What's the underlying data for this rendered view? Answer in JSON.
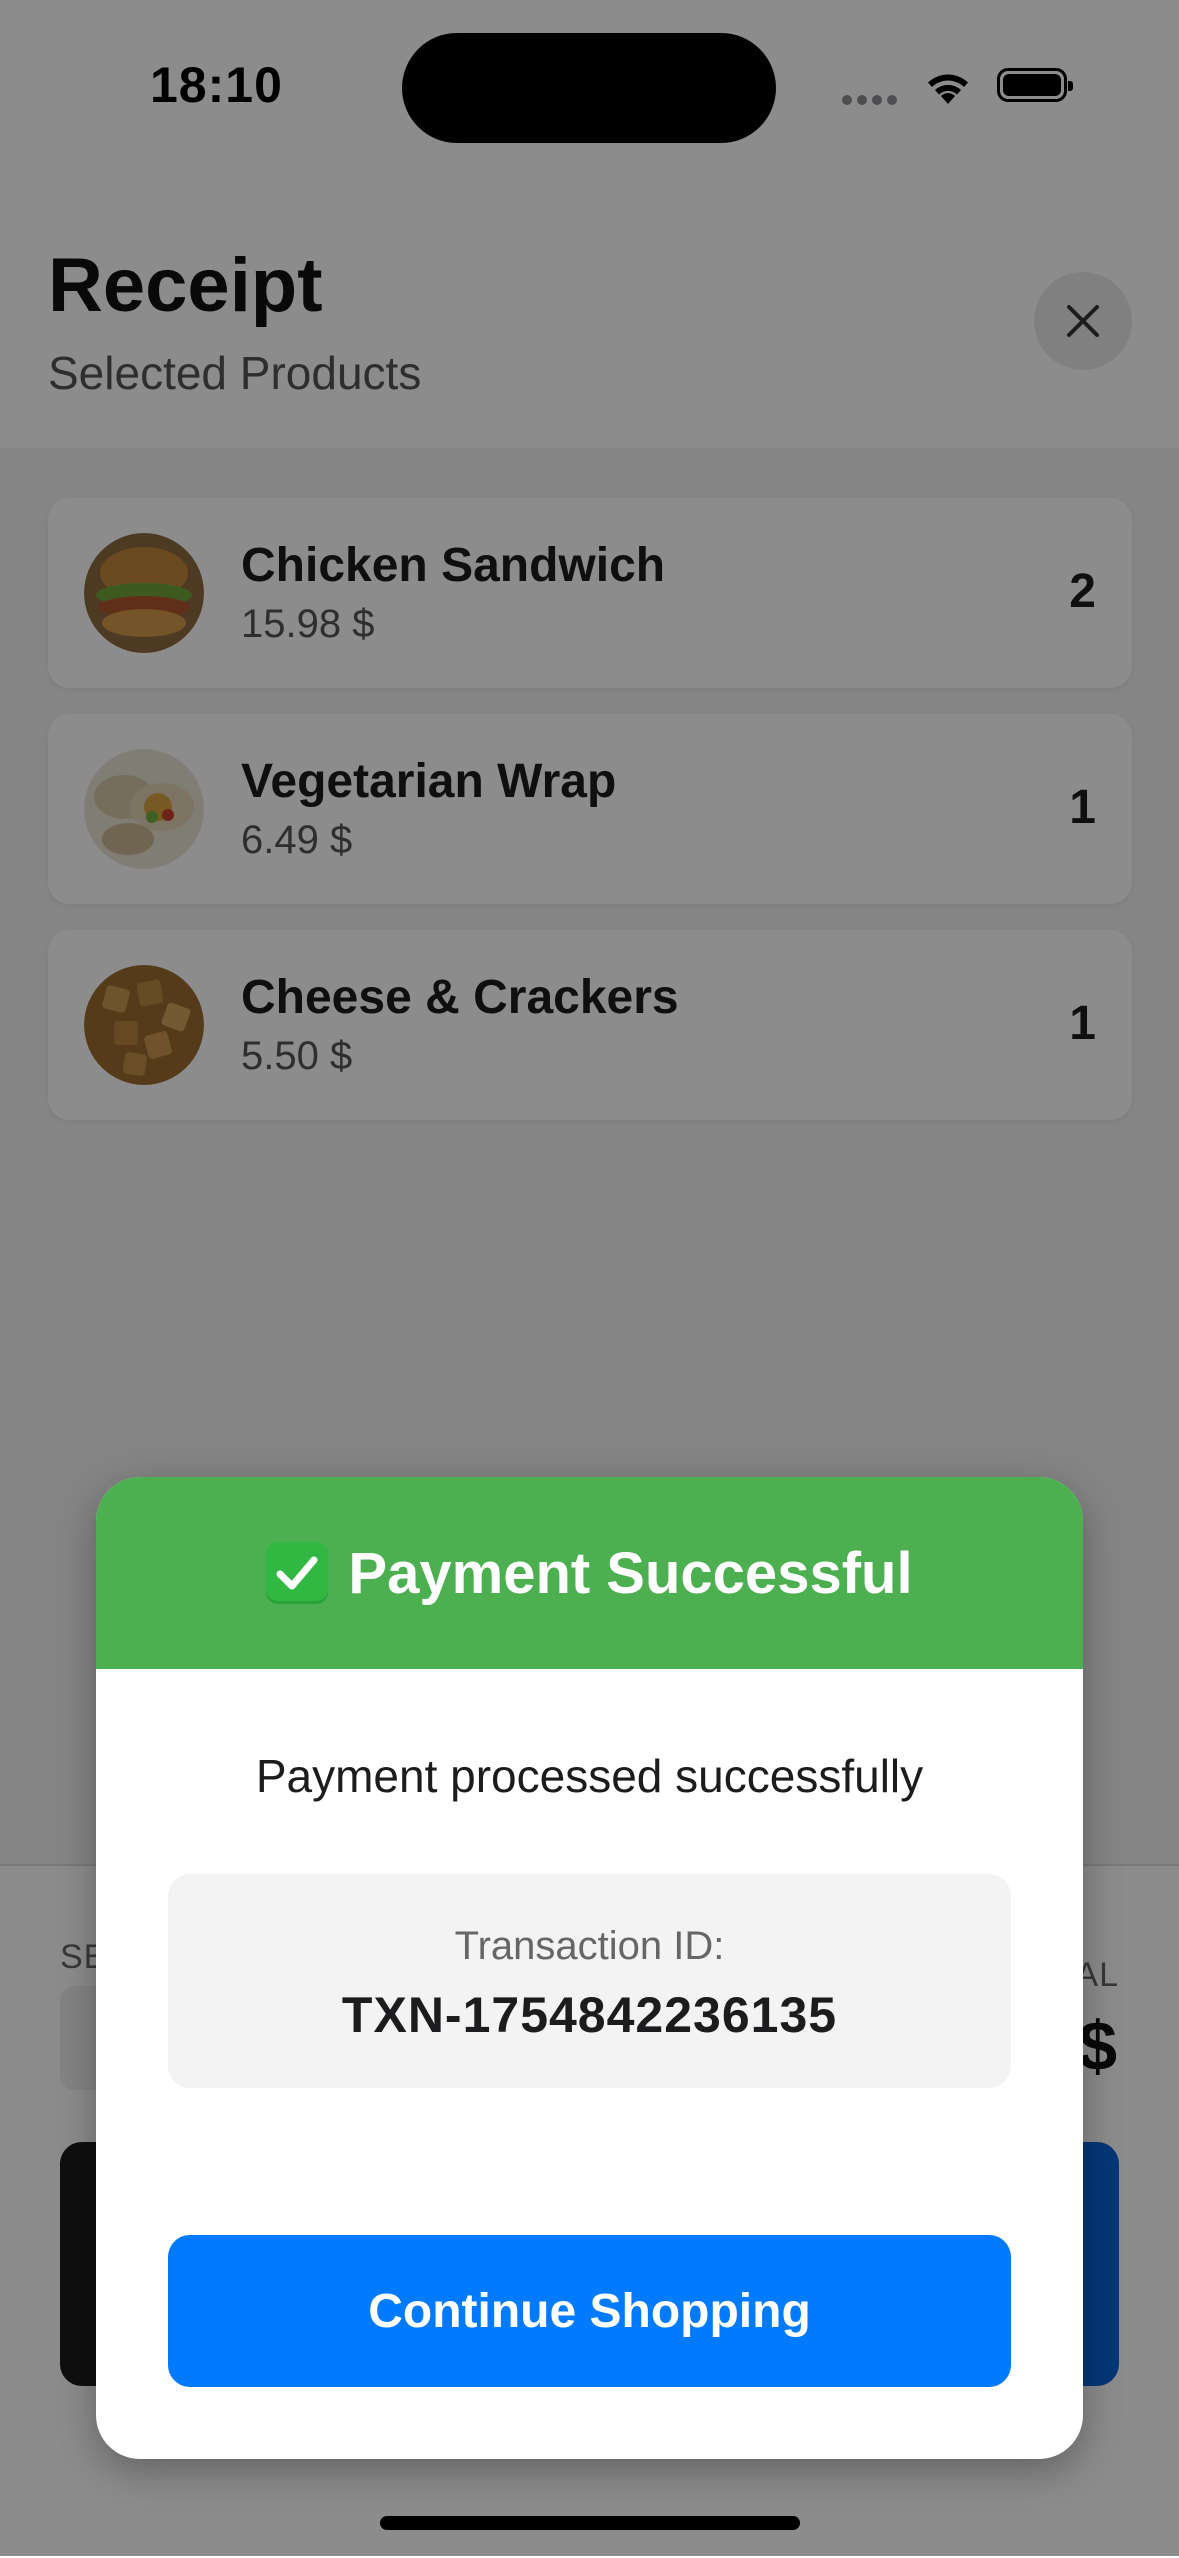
{
  "status_bar": {
    "time": "18:10"
  },
  "header": {
    "title": "Receipt",
    "subtitle": "Selected Products",
    "close_icon": "close-icon"
  },
  "products": [
    {
      "name": "Chicken Sandwich",
      "price": "15.98 $",
      "quantity": "2",
      "thumb_icon": "sandwich-thumbnail"
    },
    {
      "name": "Vegetarian Wrap",
      "price": "6.49 $",
      "quantity": "1",
      "thumb_icon": "wrap-thumbnail"
    },
    {
      "name": "Cheese & Crackers",
      "price": "5.50 $",
      "quantity": "1",
      "thumb_icon": "crackers-thumbnail"
    }
  ],
  "bottom_bar": {
    "selected_label": "SE",
    "total_label": "AL",
    "total_value": "$"
  },
  "dialog": {
    "title": "Payment Successful",
    "title_icon": "check-icon",
    "message": "Payment processed successfully",
    "transaction_label": "Transaction ID:",
    "transaction_id": "TXN-1754842236135",
    "button_label": "Continue Shopping",
    "header_color": "#4caf50",
    "button_color": "#007aff"
  }
}
